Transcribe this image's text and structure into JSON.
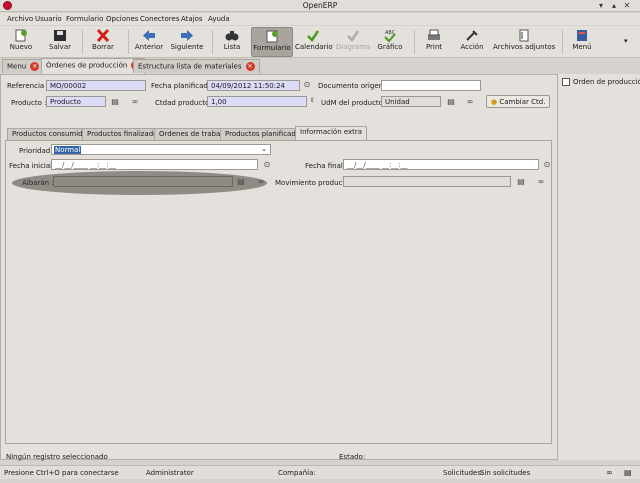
{
  "window": {
    "title": "OpenERP"
  },
  "menu": [
    "Archivo",
    "Usuario",
    "Formulario",
    "Opciones",
    "Conectores",
    "Atajos",
    "Ayuda"
  ],
  "toolbar": {
    "new": "Nuevo",
    "save": "Salvar",
    "delete": "Borrar",
    "previous": "Anterior",
    "next": "Siguiente",
    "list": "Lista",
    "form": "Formulario",
    "calendar": "Calendario",
    "diagram": "Diagrama",
    "graph": "Gráfico",
    "print": "Print",
    "action": "Acción",
    "attachments": "Archivos adjuntos",
    "menu": "Menú"
  },
  "tabs": [
    "Menu",
    "Órdenes de producción",
    "Estructura lista de materiales"
  ],
  "form": {
    "referencia_label": "Referencia :",
    "referencia_value": "MO/00002",
    "fecha_planificada_label": "Fecha planificada :",
    "fecha_planificada_value": "04/09/2012 11:50:24",
    "documento_origen_label": "Documento origen :",
    "documento_origen_value": "",
    "producto_label": "Producto :",
    "producto_value": "Producto",
    "ctdad_label": "Ctdad producto :",
    "ctdad_value": "1,00",
    "udm_label": "UdM del producto :",
    "udm_value": "Unidad",
    "cambiar_label": "Cambiar Ctd."
  },
  "right_panel": {
    "orden_label": "Orden de producción"
  },
  "inner_tabs": [
    "Productos consumidos",
    "Productos finalizados",
    "Ordenes de trabajo",
    "Productos planificados",
    "Información extra"
  ],
  "extra": {
    "prioridad_label": "Prioridad :",
    "prioridad_value": "Normal",
    "fecha_inicial_label": "Fecha inicial :",
    "fecha_inicial_placeholder": "__/__/____ __:__:__",
    "fecha_final_label": "Fecha final :",
    "fecha_final_placeholder": "__/__/____ __:__:__",
    "albaran_label": "Albarán :",
    "movimiento_label": "Movimiento producto :"
  },
  "status": {
    "record": "Ningún registro seleccionado",
    "estado": "Estado:",
    "connect": "Presione Ctrl+O para conectarse",
    "user": "Administrator",
    "company": "Compañía:",
    "requests_label": "Solicitudes:",
    "requests_value": "Sin solicitudes"
  }
}
